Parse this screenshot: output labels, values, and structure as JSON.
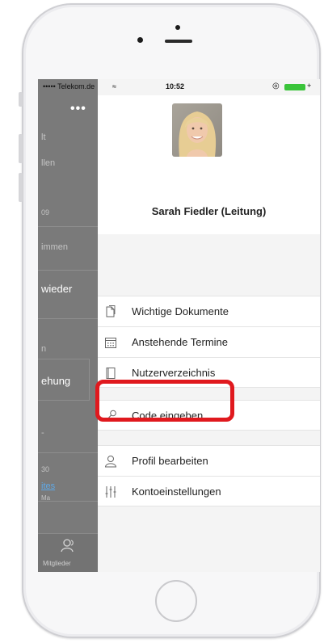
{
  "status_bar": {
    "carrier": "••••• Telekom.de",
    "time": "10:52"
  },
  "background_app": {
    "menu_glyph": "•••",
    "fragments": [
      "lt",
      "llen",
      "09",
      "immen",
      "wieder",
      "n",
      "ehung",
      "-",
      "30",
      "ites",
      "Ma"
    ],
    "tab_label": "Mitglieder"
  },
  "profile": {
    "name": "Sarah Fiedler (Leitung)"
  },
  "menu_groups": [
    {
      "items": [
        {
          "label": "Wichtige Dokumente",
          "icon": "documents-icon"
        },
        {
          "label": "Anstehende Termine",
          "icon": "calendar-icon"
        },
        {
          "label": "Nutzerverzeichnis",
          "icon": "directory-icon"
        }
      ]
    },
    {
      "items": [
        {
          "label": "Code eingeben",
          "icon": "key-icon"
        }
      ]
    },
    {
      "items": [
        {
          "label": "Profil bearbeiten",
          "icon": "user-icon"
        },
        {
          "label": "Kontoeinstellungen",
          "icon": "sliders-icon"
        }
      ]
    }
  ],
  "colors": {
    "highlight": "#e0191e",
    "battery": "#3ac43a",
    "overlay": "#7a7a7a"
  }
}
